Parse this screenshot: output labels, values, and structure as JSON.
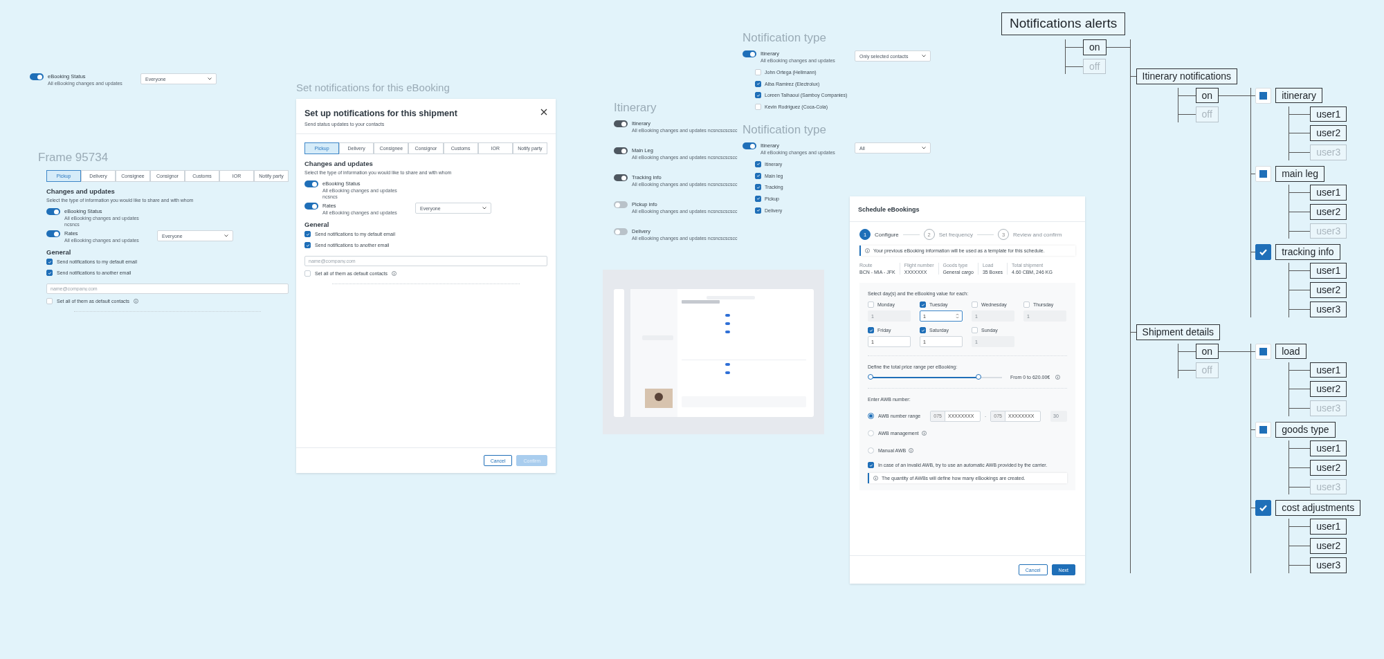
{
  "top_fragment": {
    "toggle": {
      "label": "eBooking Status",
      "description": "All eBooking changes and updates",
      "on": true
    },
    "dropdown": "Everyone"
  },
  "frame_95734": {
    "title": "Frame 95734",
    "tabs": [
      {
        "label": "Pickup",
        "selected": true
      },
      {
        "label": "Delivery",
        "selected": false
      },
      {
        "label": "Consignee",
        "selected": false
      },
      {
        "label": "Consignor",
        "selected": false
      },
      {
        "label": "Customs",
        "selected": false
      },
      {
        "label": "IOR",
        "selected": false
      },
      {
        "label": "Notify party",
        "selected": false
      }
    ],
    "section_title": "Changes and updates",
    "section_subtitle": "Select the type of information you would like to share and with whom",
    "toggles": [
      {
        "label": "eBooking Status",
        "description": "All eBooking changes and updates",
        "note": "ncsncs",
        "on": true
      },
      {
        "label": "Rates",
        "description": "All eBooking changes and updates",
        "on": true,
        "dropdown": "Everyone"
      }
    ],
    "general_title": "General",
    "checkboxes": [
      {
        "label": "Send notifications to my default email",
        "checked": true
      },
      {
        "label": "Send notifications to another email",
        "checked": true
      }
    ],
    "email_field": {
      "placeholder": "name@company.com"
    },
    "default_contacts": {
      "label": "Set all of them as default contacts",
      "checked": false
    }
  },
  "notifications_dialog": {
    "caption": "Set notifications for this eBooking",
    "title": "Set up notifications for this shipment",
    "subtitle": "Send status updates to your contacts",
    "tabs": [
      {
        "label": "Pickup",
        "selected": true
      },
      {
        "label": "Delivery",
        "selected": false
      },
      {
        "label": "Consignee",
        "selected": false
      },
      {
        "label": "Consignor",
        "selected": false
      },
      {
        "label": "Customs",
        "selected": false
      },
      {
        "label": "IOR",
        "selected": false
      },
      {
        "label": "Notify party",
        "selected": false
      }
    ],
    "section_title": "Changes and updates",
    "section_subtitle": "Select the type of information you would like to share and with whom",
    "toggles": [
      {
        "label": "eBooking Status",
        "description": "All eBooking changes and updates",
        "note": "ncsncs",
        "on": true
      },
      {
        "label": "Rates",
        "description": "All eBooking changes and updates",
        "on": true,
        "dropdown": "Everyone"
      }
    ],
    "general_title": "General",
    "checkboxes": [
      {
        "label": "Send notifications to my default email",
        "checked": true
      },
      {
        "label": "Send notifications to another email",
        "checked": true
      }
    ],
    "email_field": {
      "placeholder": "name@company.com"
    },
    "default_contacts": {
      "label": "Set all of them as default contacts",
      "checked": false
    },
    "buttons": [
      {
        "label": "Cancel",
        "kind": "secondary",
        "disabled": false
      },
      {
        "label": "Confirm",
        "kind": "primary",
        "disabled": true
      }
    ]
  },
  "itinerary_panel": {
    "title": "Itinerary",
    "toggles": [
      {
        "label": "Itinerary",
        "description": "All eBooking changes and updates ncsncscscscc",
        "on": true
      },
      {
        "label": "Main Leg",
        "description": "All eBooking changes and updates ncsncscscscc",
        "on": true
      },
      {
        "label": "Tracking info",
        "description": "All eBooking changes and updates ncsncscscscc",
        "on": true
      },
      {
        "label": "Pickup info",
        "description": "All eBooking changes and updates ncsncscscscc",
        "on": false
      },
      {
        "label": "Delivery",
        "description": "All eBooking changes and updates ncsncscscscc",
        "on": false
      }
    ]
  },
  "notification_type_contacts": {
    "title": "Notification type",
    "toggle": {
      "label": "Itinerary",
      "description": "All eBooking changes and updates",
      "on": true
    },
    "dropdown": "Only selected contacts",
    "options": [
      {
        "label": "John Ortega (Hellmann)",
        "checked": false
      },
      {
        "label": "Alba Ramirez (Electrolux)",
        "checked": true
      },
      {
        "label": "Loreen Talhaoui (Samboy Companies)",
        "checked": true
      },
      {
        "label": "Kevin Rodriguez (Coca-Cola)",
        "checked": false
      }
    ]
  },
  "notification_type_all": {
    "title": "Notification type",
    "toggle": {
      "label": "Itinerary",
      "description": "All eBooking changes and updates",
      "on": true
    },
    "dropdown": "All",
    "options": [
      {
        "label": "Itinerary",
        "checked": true
      },
      {
        "label": "Main leg",
        "checked": true
      },
      {
        "label": "Tracking",
        "checked": true
      },
      {
        "label": "Pickup",
        "checked": true
      },
      {
        "label": "Delivery",
        "checked": true
      }
    ]
  },
  "schedule_dialog": {
    "title": "Schedule eBookings",
    "steps": [
      {
        "number": "1",
        "label": "Configure",
        "selected": true
      },
      {
        "number": "2",
        "label": "Set frequency",
        "selected": false
      },
      {
        "number": "3",
        "label": "Review and confirm",
        "selected": false
      }
    ],
    "template_notice": "Your previous eBooking information will be used as a template for this schedule.",
    "summary": [
      {
        "label": "Route",
        "value": "BCN - MIA - JFK"
      },
      {
        "label": "Flight number",
        "value": "XXXXXXX"
      },
      {
        "label": "Goods type",
        "value": "General cargo"
      },
      {
        "label": "Load",
        "value": "35 Boxes"
      },
      {
        "label": "Total shipment",
        "value": "4.60 CBM, 246 KG"
      }
    ],
    "days_label": "Select day(s) and the eBooking value for each:",
    "days": [
      {
        "label": "Monday",
        "checked": false,
        "value": "1",
        "focused": false
      },
      {
        "label": "Tuesday",
        "checked": true,
        "value": "1",
        "focused": true
      },
      {
        "label": "Wednesday",
        "checked": false,
        "value": "1",
        "focused": false
      },
      {
        "label": "Thursday",
        "checked": false,
        "value": "1",
        "focused": false
      },
      {
        "label": "Friday",
        "checked": true,
        "value": "1",
        "focused": false
      },
      {
        "label": "Saturday",
        "checked": true,
        "value": "1",
        "focused": false
      },
      {
        "label": "Sunday",
        "checked": false,
        "value": "1",
        "focused": false
      }
    ],
    "price_label": "Define the total price range per eBooking:",
    "price_slider": {
      "level": 0.82
    },
    "price_reading": "From 0 to 620.00€",
    "awb_label": "Enter AWB number:",
    "awb_options": [
      {
        "label": "AWB number range",
        "selected": true,
        "info": false
      },
      {
        "label": "AWB management",
        "selected": false,
        "info": true
      },
      {
        "label": "Manual AWB",
        "selected": false,
        "info": true
      }
    ],
    "awb_range": {
      "from_prefix": "075",
      "from_value": "XXXXXXXX",
      "separator": "-",
      "to_prefix": "075",
      "to_value": "XXXXXXXX",
      "count": "30"
    },
    "fallback": {
      "label": "In case of an invalid AWB, try to use an automatic AWB provided by the carrier.",
      "checked": true
    },
    "quantity_notice": "The quantity of AWBs will define how many eBookings are created.",
    "buttons": [
      {
        "label": "Cancel",
        "kind": "secondary",
        "disabled": false
      },
      {
        "label": "Next",
        "kind": "primary",
        "disabled": false
      }
    ]
  },
  "tree": {
    "label": "Notifications alerts",
    "states": [
      {
        "label": "on",
        "active": true
      },
      {
        "label": "off",
        "active": false
      }
    ],
    "children": [
      {
        "label": "Itinerary notifications",
        "states": [
          {
            "label": "on",
            "active": true
          },
          {
            "label": "off",
            "active": false
          }
        ],
        "topics": [
          {
            "label": "itinerary",
            "kind": "square",
            "users": [
              {
                "label": "user1",
                "active": true
              },
              {
                "label": "user2",
                "active": true
              },
              {
                "label": "user3",
                "active": false
              }
            ]
          },
          {
            "label": "main leg",
            "kind": "square",
            "users": [
              {
                "label": "user1",
                "active": true
              },
              {
                "label": "user2",
                "active": true
              },
              {
                "label": "user3",
                "active": false
              }
            ]
          },
          {
            "label": "tracking info",
            "kind": "check",
            "users": [
              {
                "label": "user1",
                "active": true
              },
              {
                "label": "user2",
                "active": true
              },
              {
                "label": "user3",
                "active": true
              }
            ]
          }
        ]
      },
      {
        "label": "Shipment details",
        "states": [
          {
            "label": "on",
            "active": true
          },
          {
            "label": "off",
            "active": false
          }
        ],
        "topics": [
          {
            "label": "load",
            "kind": "square",
            "users": [
              {
                "label": "user1",
                "active": true
              },
              {
                "label": "user2",
                "active": true
              },
              {
                "label": "user3",
                "active": false
              }
            ]
          },
          {
            "label": "goods type",
            "kind": "square",
            "users": [
              {
                "label": "user1",
                "active": true
              },
              {
                "label": "user2",
                "active": true
              },
              {
                "label": "user3",
                "active": false
              }
            ]
          },
          {
            "label": "cost adjustments",
            "kind": "check",
            "users": [
              {
                "label": "user1",
                "active": true
              },
              {
                "label": "user2",
                "active": true
              },
              {
                "label": "user3",
                "active": true
              }
            ]
          }
        ]
      }
    ]
  }
}
